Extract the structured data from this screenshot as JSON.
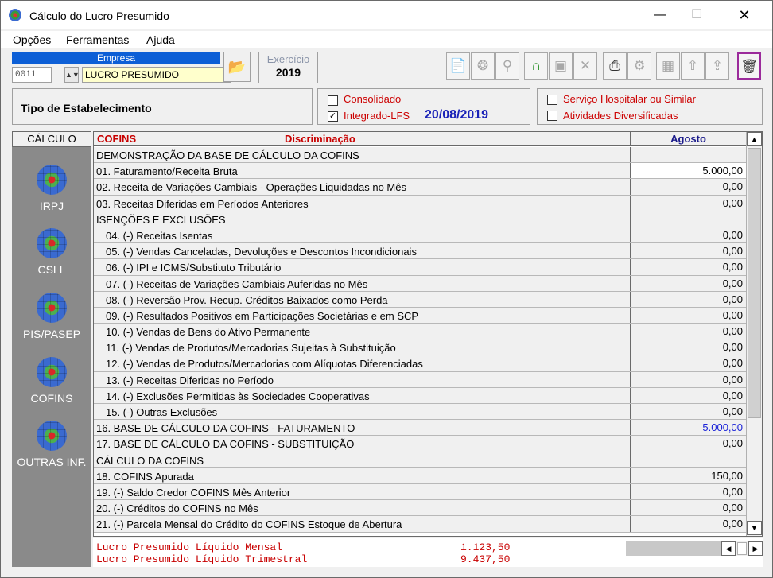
{
  "window": {
    "title": "Cálculo do Lucro Presumido"
  },
  "menu": [
    {
      "label": "Opções",
      "u": "O",
      "rest": "pções"
    },
    {
      "label": "Ferramentas",
      "u": "F",
      "rest": "erramentas"
    },
    {
      "label": "Ajuda",
      "u": "A",
      "rest": "juda"
    }
  ],
  "empresa": {
    "label": "Empresa",
    "code": "0011",
    "name": "LUCRO PRESUMIDO"
  },
  "exercicio": {
    "label": "Exercício",
    "value": "2019"
  },
  "toolbar": [
    "document-icon",
    "compass-icon",
    "search-icon",
    "lock-open-icon",
    "save-icon",
    "delete-icon",
    "print-icon",
    "wrench-icon",
    "calculator-icon",
    "upload-icon",
    "export-icon",
    "calendar-calc-icon"
  ],
  "tipo": {
    "label": "Tipo de Estabelecimento"
  },
  "options": {
    "consolidado": {
      "label": "Consolidado",
      "checked": false
    },
    "integrado": {
      "label": "Integrado-LFS",
      "checked": true
    },
    "date": "20/08/2019",
    "servico": {
      "label": "Serviço Hospitalar ou Similar",
      "checked": false
    },
    "atividades": {
      "label": "Atividades Diversificadas",
      "checked": false
    }
  },
  "sidebar": {
    "header": "CÁLCULO",
    "items": [
      "IRPJ",
      "CSLL",
      "PIS/PASEP",
      "COFINS",
      "OUTRAS INF."
    ]
  },
  "grid": {
    "col_cofins": "COFINS",
    "col_disc": "Discriminação",
    "col_month": "Agosto",
    "rows": [
      {
        "desc": "DEMONSTRAÇÃO DA BASE DE CÁLCULO DA COFINS",
        "value": ""
      },
      {
        "desc": "01. Faturamento/Receita Bruta",
        "value": "5.000,00"
      },
      {
        "desc": "02. Receita de Variações Cambiais - Operações Liquidadas no Mês",
        "value": "0,00"
      },
      {
        "desc": "03. Receitas Diferidas em Períodos Anteriores",
        "value": "0,00"
      },
      {
        "desc": "ISENÇÕES E EXCLUSÕES",
        "value": ""
      },
      {
        "desc": "04. (-) Receitas Isentas",
        "value": "0,00"
      },
      {
        "desc": "05. (-) Vendas Canceladas, Devoluções e Descontos Incondicionais",
        "value": "0,00"
      },
      {
        "desc": "06. (-) IPI e ICMS/Substituto Tributário",
        "value": "0,00"
      },
      {
        "desc": "07. (-) Receitas de Variações Cambiais Auferidas no Mês",
        "value": "0,00"
      },
      {
        "desc": "08. (-) Reversão Prov. Recup. Créditos Baixados como Perda",
        "value": "0,00"
      },
      {
        "desc": "09. (-) Resultados Positivos em Participações Societárias e em SCP",
        "value": "0,00"
      },
      {
        "desc": "10. (-) Vendas de Bens do Ativo Permanente",
        "value": "0,00"
      },
      {
        "desc": "11. (-) Vendas de Produtos/Mercadorias Sujeitas à Substituição",
        "value": "0,00"
      },
      {
        "desc": "12. (-) Vendas de Produtos/Mercadorias com Alíquotas Diferenciadas",
        "value": "0,00"
      },
      {
        "desc": "13. (-) Receitas Diferidas no Período",
        "value": "0,00"
      },
      {
        "desc": "14. (-) Exclusões Permitidas às Sociedades Cooperativas",
        "value": "0,00"
      },
      {
        "desc": "15. (-) Outras Exclusões",
        "value": "0,00"
      },
      {
        "desc": "16. BASE DE CÁLCULO DA COFINS - FATURAMENTO",
        "value": "5.000,00"
      },
      {
        "desc": "17. BASE DE CÁLCULO DA COFINS - SUBSTITUIÇÃO",
        "value": "0,00"
      },
      {
        "desc": "CÁLCULO DA COFINS",
        "value": ""
      },
      {
        "desc": "18. COFINS Apurada",
        "value": "150,00"
      },
      {
        "desc": "19. (-) Saldo Credor COFINS Mês Anterior",
        "value": "0,00"
      },
      {
        "desc": "20. (-) Créditos do COFINS no Mês",
        "value": "0,00"
      },
      {
        "desc": "21. (-) Parcela Mensal do Crédito do COFINS Estoque de Abertura",
        "value": "0,00"
      }
    ]
  },
  "totals": {
    "mensal_label": "Lucro Presumido Líquido Mensal",
    "mensal_value": "1.123,50",
    "trimestral_label": "Lucro Presumido Líquido Trimestral",
    "trimestral_value": "9.437,50"
  },
  "colors": {
    "accent": "#0d5fd6",
    "red": "#c80000",
    "blue": "#1a22d8",
    "highlight": "#9b2a9b"
  }
}
